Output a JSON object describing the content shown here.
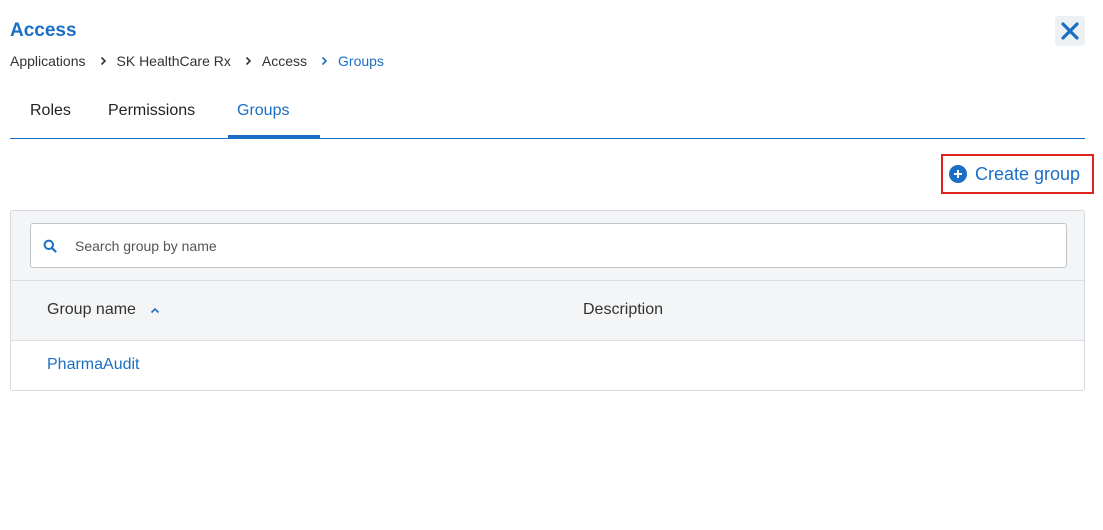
{
  "header": {
    "title": "Access",
    "close_icon": "close-icon"
  },
  "breadcrumb": {
    "items": [
      "Applications",
      "SK HealthCare Rx",
      "Access",
      "Groups"
    ]
  },
  "tabs": [
    {
      "label": "Roles",
      "active": false
    },
    {
      "label": "Permissions",
      "active": false
    },
    {
      "label": "Groups",
      "active": true
    }
  ],
  "toolbar": {
    "create_label": "Create group",
    "create_icon": "plus-circle-icon",
    "highlight_color": "#e0231f"
  },
  "search": {
    "placeholder": "Search group by name",
    "value": "",
    "icon": "search-icon"
  },
  "table": {
    "columns": [
      "Group name",
      "Description"
    ],
    "sort": {
      "column": "Group name",
      "direction": "ascending"
    },
    "rows": [
      {
        "name": "PharmaAudit",
        "description": ""
      }
    ]
  },
  "colors": {
    "accent": "#1a6fc4"
  }
}
